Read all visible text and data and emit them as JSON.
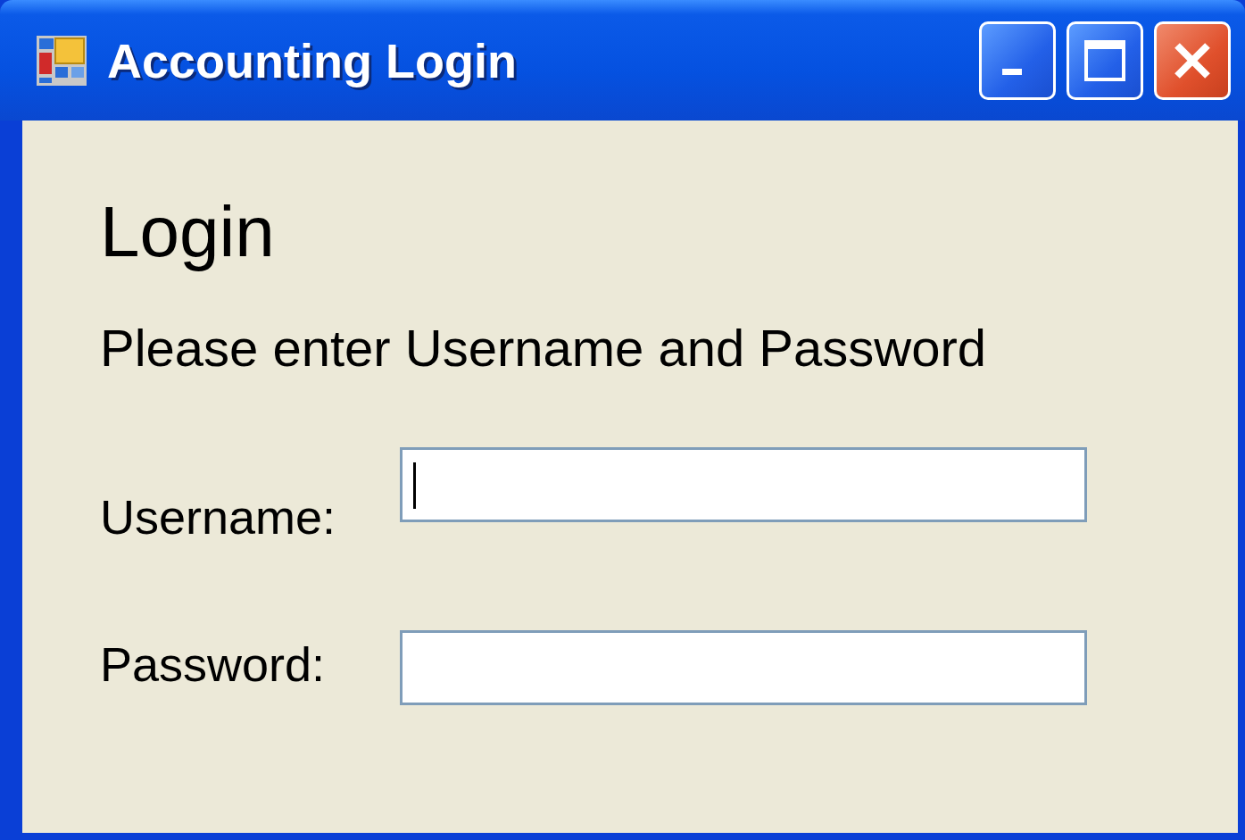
{
  "window": {
    "title": "Accounting Login"
  },
  "heading": "Login",
  "instruction": "Please enter Username and Password",
  "fields": [
    {
      "label": "Username:",
      "focused": true
    },
    {
      "label": "Password:",
      "focused": false
    }
  ]
}
